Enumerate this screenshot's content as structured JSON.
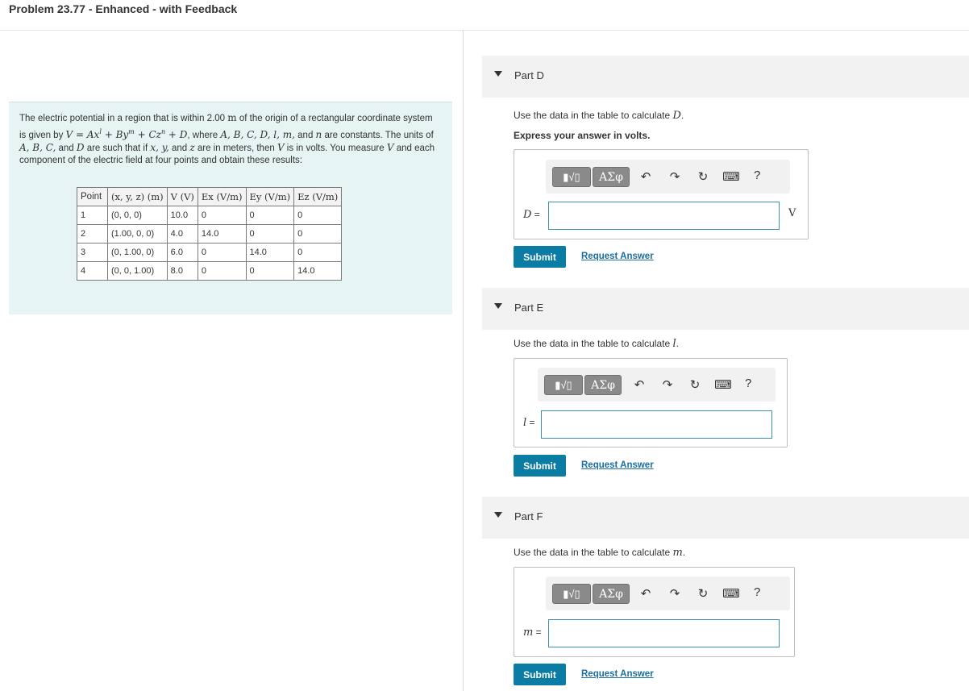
{
  "header": {
    "title": "Problem 23.77 - Enhanced - with Feedback"
  },
  "problem": {
    "text_1": "The electric potential in a region that is within 2.00 ",
    "unit_m": "m",
    "text_2": " of the origin of a rectangular coordinate system is given by ",
    "formula": "V = Ax",
    "exp_l": "l",
    "formula_b": " + By",
    "exp_m": "m",
    "formula_c": " + Cz",
    "exp_n": "n",
    "formula_d": " + D",
    "text_3": ", where ",
    "vars": "A, B, C, D, l, m,",
    "text_4": " and ",
    "var_n": "n",
    "text_5": " are constants. The units of ",
    "vars2": "A, B, C,",
    "text_6": " and ",
    "var_D": "D",
    "text_7": " are such that if ",
    "vars3": "x, y,",
    "text_8": " and ",
    "var_z": "z",
    "text_9": " are in meters, then ",
    "var_V": "V",
    "text_10": " is in volts. You measure ",
    "var_V2": "V",
    "text_11": " and each component of the electric field at four points and obtain these results:"
  },
  "table": {
    "headers": [
      "Point",
      "(x, y, z) (m)",
      "V (V)",
      "Ex (V/m)",
      "Ey (V/m)",
      "Ez (V/m)"
    ],
    "rows": [
      [
        "1",
        "(0, 0, 0)",
        "10.0",
        "0",
        "0",
        "0"
      ],
      [
        "2",
        "(1.00, 0, 0)",
        "4.0",
        "14.0",
        "0",
        "0"
      ],
      [
        "3",
        "(0, 1.00, 0)",
        "6.0",
        "0",
        "14.0",
        "0"
      ],
      [
        "4",
        "(0, 0, 1.00)",
        "8.0",
        "0",
        "0",
        "14.0"
      ]
    ]
  },
  "parts": {
    "D": {
      "label": "Part D",
      "instruction": "Use the data in the table to calculate ",
      "variable": "D",
      "instruction_end": ".",
      "express": "Express your answer in volts.",
      "var_label": "D",
      "eq": " =",
      "unit": "V",
      "value": ""
    },
    "E": {
      "label": "Part E",
      "instruction": "Use the data in the table to calculate ",
      "variable": "l",
      "instruction_end": ".",
      "var_label": "l",
      "eq": " =",
      "value": ""
    },
    "F": {
      "label": "Part F",
      "instruction": "Use the data in the table to calculate ",
      "variable": "m",
      "instruction_end": ".",
      "var_label": "m",
      "eq": " =",
      "value": ""
    }
  },
  "toolbar": {
    "template_label": "▮√▯",
    "greek_label": "ΑΣφ",
    "undo": "↶",
    "redo": "↷",
    "reset": "↻",
    "keyboard": "⌨",
    "help": "?"
  },
  "buttons": {
    "submit": "Submit",
    "request": "Request Answer"
  },
  "colors": {
    "accent": "#0b7ca3",
    "problem_bg": "#e6f4f4",
    "part_header_bg": "#f2f2f2"
  }
}
